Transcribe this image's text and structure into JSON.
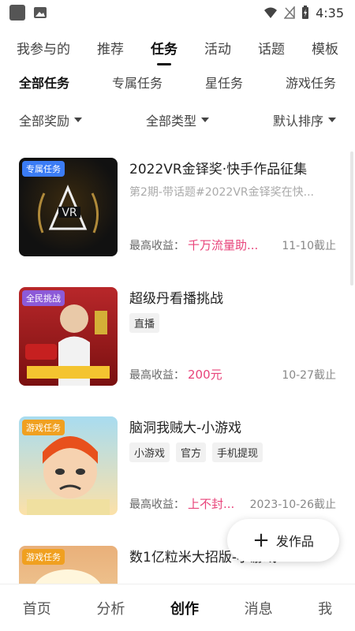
{
  "status_bar": {
    "time": "4:35"
  },
  "top_tabs": [
    {
      "label": "我参与的"
    },
    {
      "label": "推荐"
    },
    {
      "label": "任务"
    },
    {
      "label": "活动"
    },
    {
      "label": "话题"
    },
    {
      "label": "模板"
    }
  ],
  "sub_tabs": [
    {
      "label": "全部任务"
    },
    {
      "label": "专属任务"
    },
    {
      "label": "星任务"
    },
    {
      "label": "游戏任务"
    }
  ],
  "filters": [
    {
      "label": "全部奖励"
    },
    {
      "label": "全部类型"
    },
    {
      "label": "默认排序"
    }
  ],
  "cards": [
    {
      "tag": "专属任务",
      "tag_color": "#3b7cf5",
      "title": "2022VR金铎奖·快手作品征集",
      "subtitle": "第2期-带话题#2022VR金铎奖在快...",
      "chips": [],
      "reward_label": "最高收益：",
      "reward_value": "千万流量助...",
      "deadline": "11-10截止"
    },
    {
      "tag": "全民挑战",
      "tag_color": "#8c5ad8",
      "title": "超级丹看播挑战",
      "subtitle": "",
      "chips": [
        "直播"
      ],
      "reward_label": "最高收益：",
      "reward_value": "200元",
      "deadline": "10-27截止"
    },
    {
      "tag": "游戏任务",
      "tag_color": "#f0a020",
      "title": "脑洞我贼大-小游戏",
      "subtitle": "",
      "chips": [
        "小游戏",
        "官方",
        "手机提现"
      ],
      "reward_label": "最高收益：",
      "reward_value": "上不封...",
      "deadline": "2023-10-26截止"
    },
    {
      "tag": "游戏任务",
      "tag_color": "#f0a020",
      "title": "数1亿粒米大招版-小游戏",
      "subtitle": "",
      "chips": [],
      "reward_label": "",
      "reward_value": "",
      "deadline": ""
    }
  ],
  "fab": {
    "label": "发作品"
  },
  "bottom_nav": [
    {
      "label": "首页"
    },
    {
      "label": "分析"
    },
    {
      "label": "创作"
    },
    {
      "label": "消息"
    },
    {
      "label": "我"
    }
  ]
}
